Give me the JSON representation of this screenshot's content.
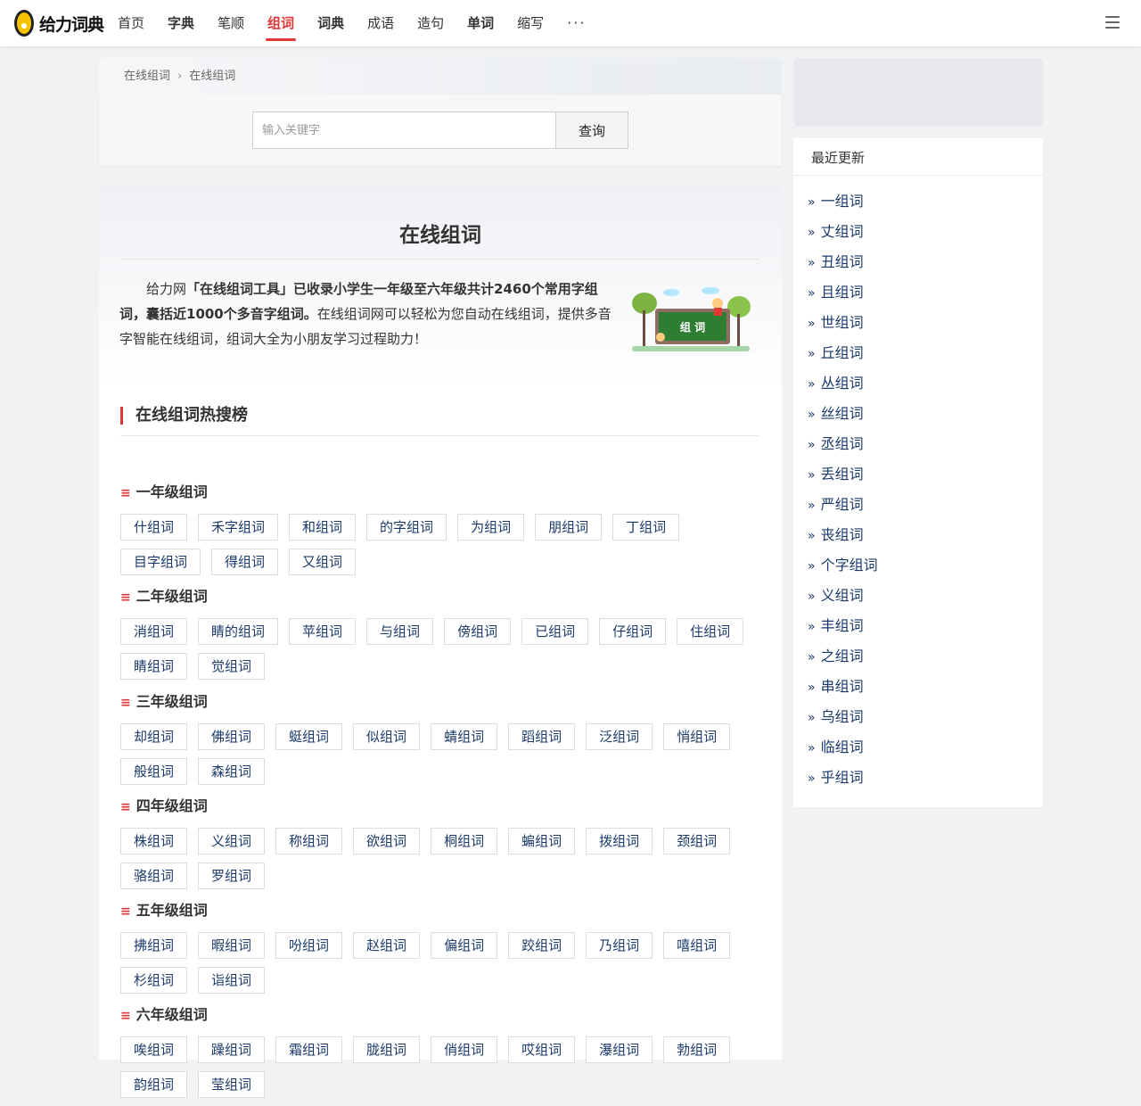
{
  "header": {
    "logo_text": "给力词典",
    "nav": [
      {
        "label": "首页",
        "style": "normal"
      },
      {
        "label": "字典",
        "style": "bold"
      },
      {
        "label": "笔顺",
        "style": "normal"
      },
      {
        "label": "组词",
        "style": "active"
      },
      {
        "label": "词典",
        "style": "bold"
      },
      {
        "label": "成语",
        "style": "normal"
      },
      {
        "label": "造句",
        "style": "normal"
      },
      {
        "label": "单词",
        "style": "bold"
      },
      {
        "label": "缩写",
        "style": "normal"
      }
    ],
    "more_label": "···",
    "accent_color": "#e03636"
  },
  "breadcrumb": {
    "first": "在线组词",
    "separator": "›",
    "current": "在线组词"
  },
  "search": {
    "placeholder": "输入关键字",
    "button": "查询"
  },
  "intro": {
    "title": "在线组词",
    "text_prefix": "给力网",
    "text_bold": "「在线组词工具」已收录小学生一年级至六年级共计2460个常用字组词，囊括近1000个多音字组词。",
    "text_rest": "在线组词网可以轻松为您自动在线组词，提供多音字智能在线组词，组词大全为小朋友学习过程助力！",
    "image_label": "组 词"
  },
  "hot": {
    "heading": "在线组词热搜榜",
    "grades": [
      {
        "title": "一年级组词",
        "tags": [
          "什组词",
          "禾字组词",
          "和组词",
          "的字组词",
          "为组词",
          "朋组词",
          "丁组词",
          "目字组词",
          "得组词",
          "又组词"
        ]
      },
      {
        "title": "二年级组词",
        "tags": [
          "消组词",
          "睛的组词",
          "苹组词",
          "与组词",
          "傍组词",
          "已组词",
          "仔组词",
          "住组词",
          "睛组词",
          "觉组词"
        ]
      },
      {
        "title": "三年级组词",
        "tags": [
          "却组词",
          "佛组词",
          "蜓组词",
          "似组词",
          "蜻组词",
          "蹈组词",
          "泛组词",
          "悄组词",
          "般组词",
          "森组词"
        ]
      },
      {
        "title": "四年级组词",
        "tags": [
          "株组词",
          "义组词",
          "称组词",
          "欲组词",
          "桐组词",
          "蝙组词",
          "拨组词",
          "颈组词",
          "骆组词",
          "罗组词"
        ]
      },
      {
        "title": "五年级组词",
        "tags": [
          "拂组词",
          "暇组词",
          "吩组词",
          "赵组词",
          "偏组词",
          "跤组词",
          "乃组词",
          "嘻组词",
          "杉组词",
          "诣组词"
        ]
      },
      {
        "title": "六年级组词",
        "tags": [
          "唉组词",
          "躁组词",
          "霜组词",
          "胧组词",
          "俏组词",
          "哎组词",
          "瀑组词",
          "勃组词",
          "韵组词",
          "莹组词"
        ]
      }
    ]
  },
  "sidebar": {
    "title": "最近更新",
    "bullet": "»",
    "items": [
      "一组词",
      "丈组词",
      "丑组词",
      "且组词",
      "世组词",
      "丘组词",
      "丛组词",
      "丝组词",
      "丞组词",
      "丢组词",
      "严组词",
      "丧组词",
      "个字组词",
      "义组词",
      "丰组词",
      "之组词",
      "串组词",
      "乌组词",
      "临组词",
      "乎组词"
    ]
  }
}
